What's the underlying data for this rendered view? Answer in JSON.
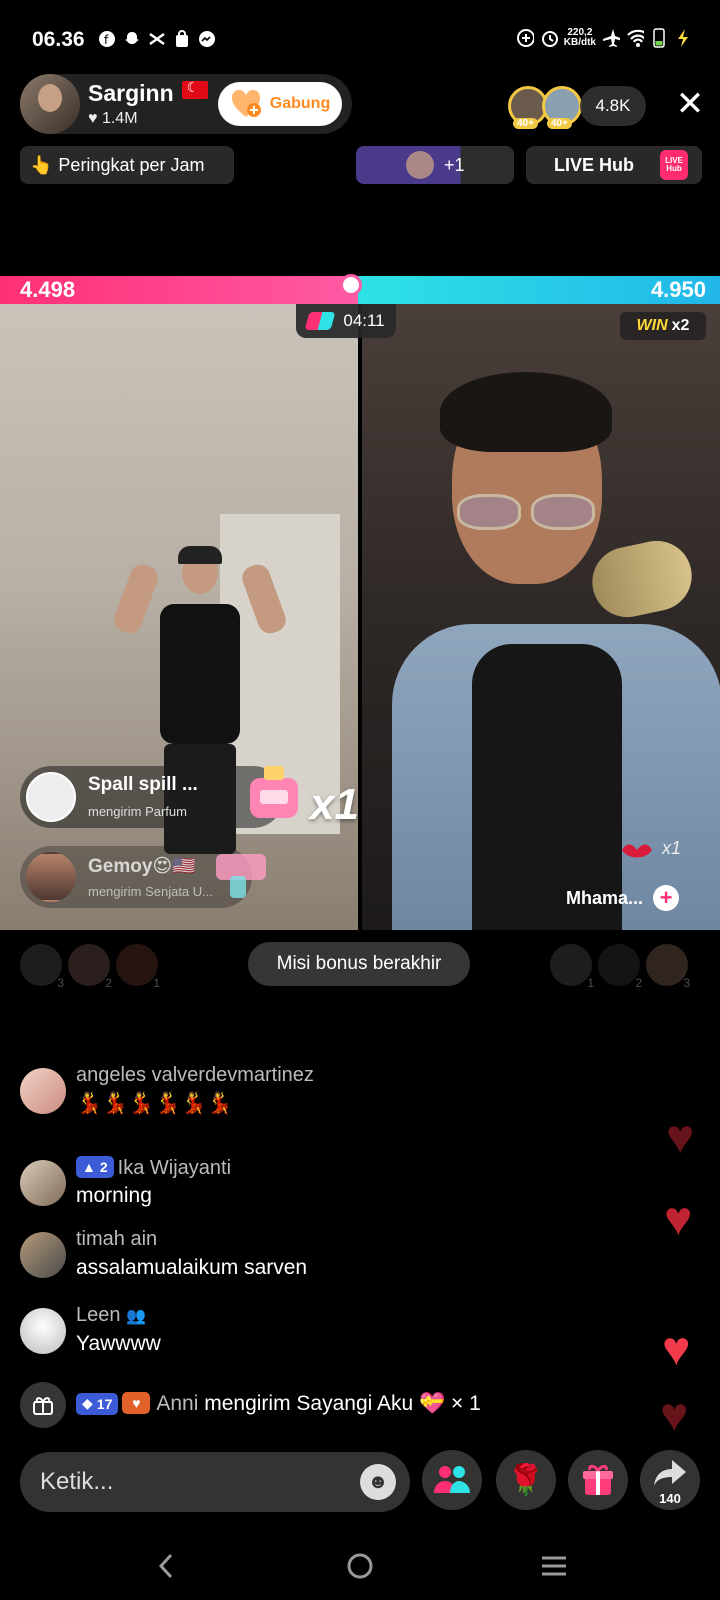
{
  "status_bar": {
    "time": "06.36",
    "net_speed_value": "220,2",
    "net_speed_unit": "KB/dtk"
  },
  "host": {
    "name": "Sarginn",
    "likes": "1.4M",
    "join_label": "Gabung"
  },
  "viewers": {
    "badge_1": "40+",
    "badge_2": "40+",
    "count": "4.8K"
  },
  "top_pills": {
    "ranking_label": "Peringkat per Jam",
    "plus_count": "+1",
    "hub_label": "LIVE Hub",
    "hub_logo_text": "LIVE Hub"
  },
  "battle": {
    "left_score": "4.498",
    "right_score": "4.950",
    "timer": "04:11",
    "win_label": "WIN",
    "win_multiplier": "x2",
    "left_combo": "x1",
    "right_combo": "x1",
    "right_sender": "Mhama...",
    "bonus_message": "Misi bonus berakhir"
  },
  "gift_toasts": [
    {
      "name": "Spall spill ...",
      "sub": "mengirim Parfum"
    },
    {
      "name": "Gemoy😍🇺🇸",
      "sub": "mengirim Senjata U..."
    }
  ],
  "supporters_left": [
    "3",
    "2",
    "1"
  ],
  "supporters_right": [
    "1",
    "2",
    "3"
  ],
  "chat": [
    {
      "name": "angeles valverdevmartinez",
      "msg": "💃💃💃💃💃💃"
    },
    {
      "name": "Ika Wijayanti",
      "level": "2",
      "msg": "morning"
    },
    {
      "name": "timah ain",
      "msg": "assalamualaikum sarven"
    },
    {
      "name": "Leen",
      "msg": "Yawwww"
    }
  ],
  "gift_line": {
    "level": "17",
    "user": "Anni",
    "text": "mengirim Sayangi Aku",
    "count": "× 1"
  },
  "input": {
    "placeholder": "Ketik..."
  },
  "share_count": "140",
  "colors": {
    "left_team": "#ff2f76",
    "right_team": "#2ee2e6",
    "heart": "#e22a3a",
    "join_text": "#ff8a1f"
  }
}
